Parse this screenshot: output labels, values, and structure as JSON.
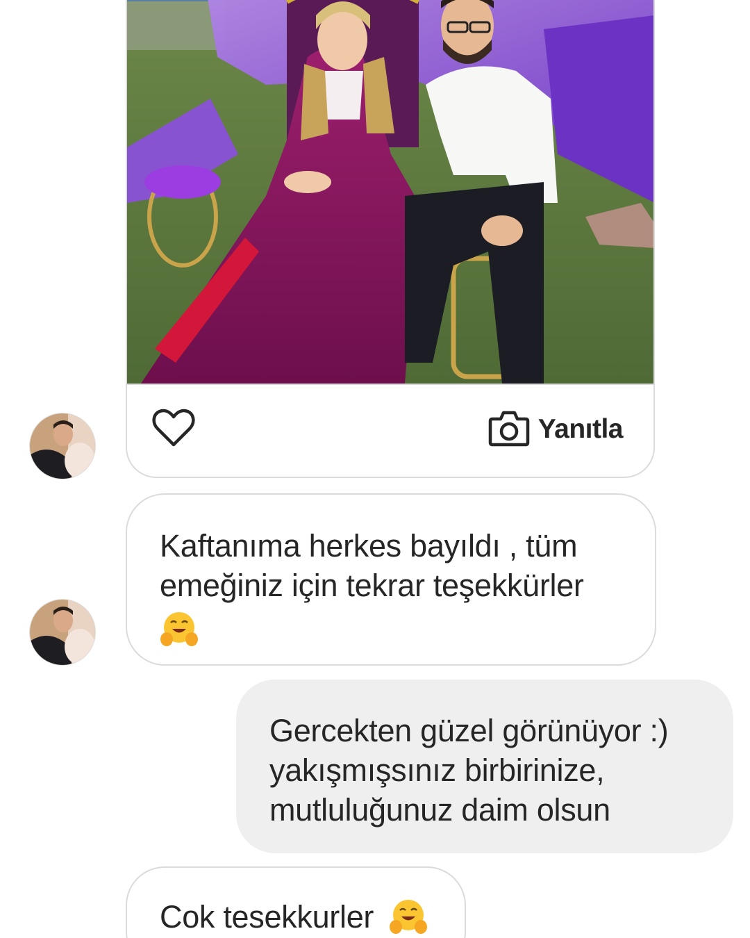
{
  "story_reply": {
    "reply_label": "Yanıtla",
    "like_icon": "heart-icon",
    "camera_icon": "camera-icon"
  },
  "messages": [
    {
      "from": "them",
      "text": "Kaftanıma herkes bayıldı , tüm\nemeğiniz için tekrar teşekkürler",
      "emoji": "hugging-face-emoji"
    },
    {
      "from": "me",
      "text": "Gercekten güzel görünüyor :)\nyakışmışsınız birbirinize,\nmutluluğunuz daim olsun"
    },
    {
      "from": "them",
      "text": "Cok tesekkurler",
      "emoji": "hugging-face-emoji"
    }
  ],
  "colors": {
    "received_bubble_border": "#dbdbdb",
    "sent_bubble_bg": "#efefef",
    "text": "#262626"
  }
}
